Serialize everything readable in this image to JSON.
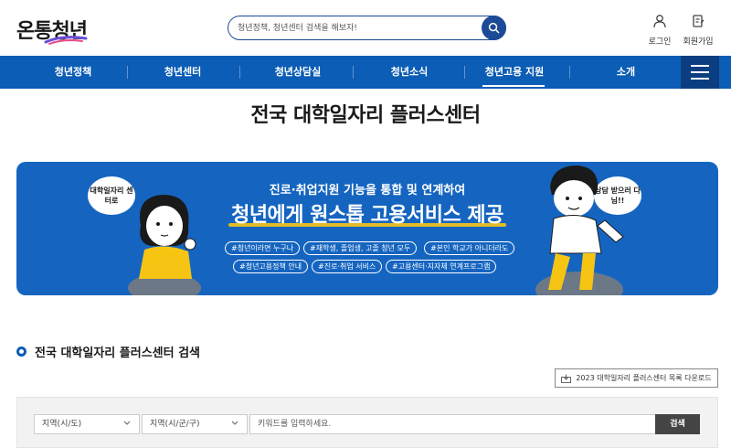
{
  "header": {
    "logo_text": "온통청년",
    "search_placeholder": "청년정책, 청년센터 검색을 해보자!",
    "login_label": "로그인",
    "signup_label": "회원가입"
  },
  "nav": {
    "items": [
      "청년정책",
      "청년센터",
      "청년상담실",
      "청년소식",
      "청년고용 지원",
      "소개"
    ],
    "active_index": 4
  },
  "page": {
    "title": "전국 대학일자리 플러스센터"
  },
  "banner": {
    "headline": "진로·취업지원 기능을 통합 및 연계하여",
    "main": "청년에게 원스톱 고용서비스 제공",
    "tags": [
      "#청년이라면 누구나",
      "#재학생, 졸업생, 고졸 청년 모두",
      "#본인 학교가 아니더라도",
      "#청년고용정책 안내",
      "#진로·취업 서비스",
      "#고용센터·지자체 연계프로그램"
    ],
    "bubble_left": "대학일자리 센터로",
    "bubble_right": "상담 받으러 다님!!"
  },
  "search_section": {
    "title": "전국 대학일자리 플러스센터 검색",
    "download_label": "2023 대학일자리 플러스센터 목록 다운로드",
    "region_sido": "지역(시/도)",
    "region_sigungu": "지역(시/군/구)",
    "keyword_placeholder": "키워드를 입력하세요.",
    "submit_label": "검색"
  },
  "colors": {
    "primary": "#0b5db5",
    "nav_menu": "#0a3e80",
    "banner": "#1565c0",
    "accent_yellow": "#f6c514"
  }
}
